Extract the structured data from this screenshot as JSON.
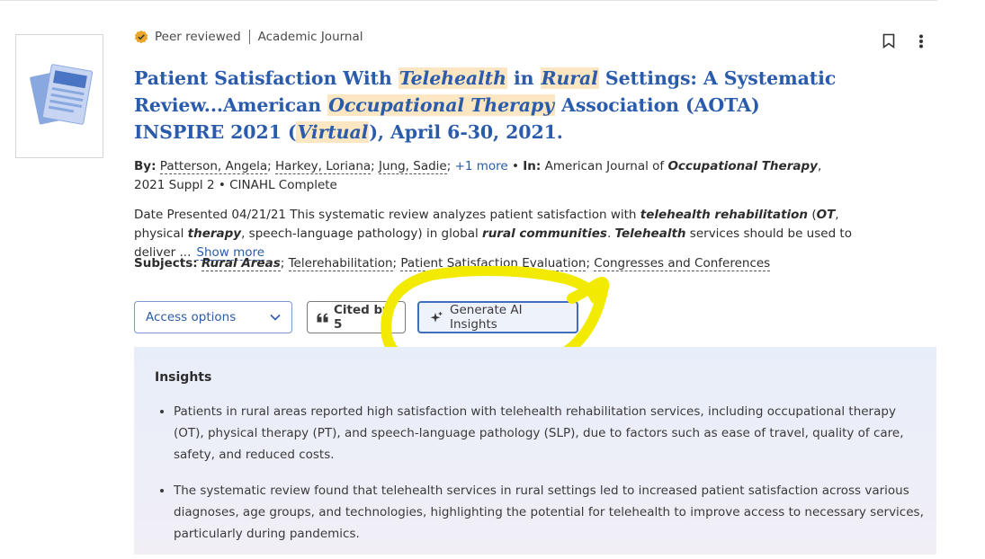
{
  "result": {
    "peer_reviewed_label": "Peer reviewed",
    "source_type": "Academic Journal",
    "title_parts": {
      "t1": "Patient Satisfaction With ",
      "h1": "Telehealth",
      "t2": " in ",
      "h2": "Rural",
      "t3": " Settings: A Systematic Review...American ",
      "h3": "Occupational Therapy",
      "t4": " Association (AOTA) INSPIRE 2021 (",
      "h4": "Virtual",
      "t5": "), April 6-30, 2021."
    },
    "byline": {
      "by_label": "By:",
      "authors": [
        "Patterson, Angela",
        "Harkey, Loriana",
        "Jung, Sadie"
      ],
      "more_authors": "+1 more",
      "in_label": "In:",
      "source_pre": "American Journal of ",
      "source_em": "Occupational Therapy",
      "source_post": ", 2021 Suppl 2",
      "database": "CINAHL Complete"
    },
    "abstract": {
      "p1": "Date Presented 04/21/21 This systematic review analyzes patient satisfaction with ",
      "e1": "telehealth rehabilitation",
      "p2": " (",
      "e2": "OT",
      "p3": ", physical ",
      "e3": "therapy",
      "p4": ", speech-language pathology) in global ",
      "e4": "rural communities",
      "p5": ". ",
      "e5": "Telehealth",
      "p6": " services should be used to deliver ...",
      "show_more": "Show more"
    },
    "subjects": {
      "label": "Subjects:",
      "items": [
        "Rural Areas",
        "Telerehabilitation",
        "Patient Satisfaction Evaluation",
        "Congresses and Conferences"
      ]
    },
    "actions": {
      "access_options": "Access options",
      "cited_by": "Cited by 5",
      "generate_ai": "Generate AI Insights"
    }
  },
  "insights": {
    "heading": "Insights",
    "bullets": [
      "Patients in rural areas reported high satisfaction with telehealth rehabilitation services, including occupational therapy (OT), physical therapy (PT), and speech-language pathology (SLP), due to factors such as ease of travel, quality of care, safety, and reduced costs.",
      "The systematic review found that telehealth services in rural settings led to increased patient satisfaction across various diagnoses, age groups, and technologies, highlighting the potential for telehealth to improve access to necessary services, particularly during pandemics."
    ]
  },
  "icons": {
    "peer_reviewed": "verified-badge-icon",
    "bookmark": "bookmark-icon",
    "more": "more-vertical-icon",
    "cited": "quote-icon",
    "ai": "sparkle-icon",
    "dropdown": "chevron-down-icon",
    "document": "document-icon"
  },
  "colors": {
    "link": "#2b5bab",
    "title_highlight": "#fde7c2",
    "badge": "#e8a72c",
    "insights_bg": "#e9eef9",
    "annotation": "#f2ea00"
  }
}
